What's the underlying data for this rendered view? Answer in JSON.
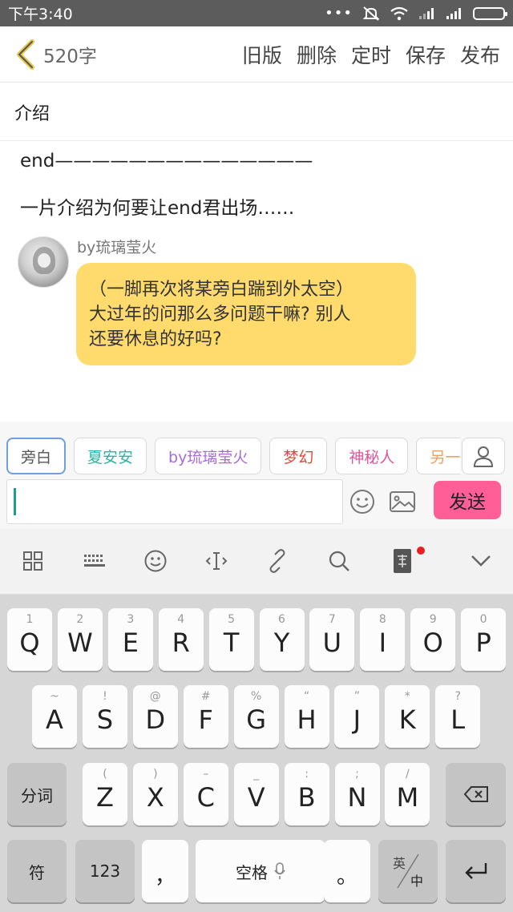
{
  "status_bar": {
    "time": "下午3:40",
    "dots": "•••"
  },
  "app_bar": {
    "word_count": "520字",
    "actions": [
      "旧版",
      "删除",
      "定时",
      "保存",
      "发布"
    ]
  },
  "section_title": "介绍",
  "content": {
    "line1": "end——————————————",
    "line2": "一片介绍为何要让end君出场……",
    "speaker": "by琉璃莹火",
    "bubble_lines": [
      "（一脚再次将某旁白踹到外太空）",
      "大过年的问那么多问题干嘛? 别人",
      "还要休息的好吗?"
    ]
  },
  "chips": [
    {
      "label": "旁白",
      "color": "#555555"
    },
    {
      "label": "夏安安",
      "color": "#2bb3a3"
    },
    {
      "label": "by琉璃莹火",
      "color": "#a66bd8"
    },
    {
      "label": "梦幻",
      "color": "#e04a3c"
    },
    {
      "label": "神秘人",
      "color": "#e0559a"
    },
    {
      "label": "另一",
      "color": "#f0a062"
    }
  ],
  "input": {
    "value": ""
  },
  "send_label": "发送",
  "toolbar_icons": [
    "grid-icon",
    "keyboard-icon",
    "smile-icon",
    "cursor-icon",
    "link-icon",
    "search-icon",
    "fa-tile-icon",
    "chevron-down-icon"
  ],
  "keyboard": {
    "row1": [
      {
        "k": "Q",
        "h": "1"
      },
      {
        "k": "W",
        "h": "2"
      },
      {
        "k": "E",
        "h": "3"
      },
      {
        "k": "R",
        "h": "4"
      },
      {
        "k": "T",
        "h": "5"
      },
      {
        "k": "Y",
        "h": "6"
      },
      {
        "k": "U",
        "h": "7"
      },
      {
        "k": "I",
        "h": "8"
      },
      {
        "k": "O",
        "h": "9"
      },
      {
        "k": "P",
        "h": "0"
      }
    ],
    "row2": [
      {
        "k": "A",
        "h": "~"
      },
      {
        "k": "S",
        "h": "!"
      },
      {
        "k": "D",
        "h": "@"
      },
      {
        "k": "F",
        "h": "#"
      },
      {
        "k": "G",
        "h": "%"
      },
      {
        "k": "H",
        "h": "“"
      },
      {
        "k": "J",
        "h": "”"
      },
      {
        "k": "K",
        "h": "*"
      },
      {
        "k": "L",
        "h": "?"
      }
    ],
    "row3": [
      {
        "k": "Z",
        "h": "("
      },
      {
        "k": "X",
        "h": ")"
      },
      {
        "k": "C",
        "h": "–"
      },
      {
        "k": "V",
        "h": "_"
      },
      {
        "k": "B",
        "h": ":"
      },
      {
        "k": "N",
        "h": ";"
      },
      {
        "k": "M",
        "h": "/"
      }
    ],
    "fenci": "分词",
    "symbols": "符",
    "numbers": "123",
    "comma": "，",
    "space": "空格",
    "period": "。",
    "lang_top": "英",
    "lang_bottom": "中"
  }
}
